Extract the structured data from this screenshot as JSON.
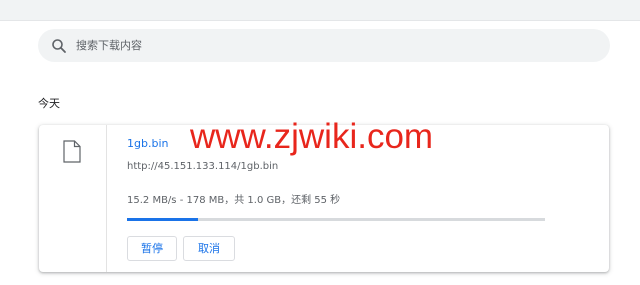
{
  "search": {
    "placeholder": "搜索下载内容"
  },
  "section": {
    "label": "今天"
  },
  "download": {
    "file_name": "1gb.bin",
    "url": "http://45.151.133.114/1gb.bin",
    "status": "15.2 MB/s - 178 MB，共 1.0 GB，还剩 55 秒",
    "progress": 0.17,
    "pause_label": "暂停",
    "cancel_label": "取消"
  },
  "watermark": "www.zjwiki.com",
  "colors": {
    "accent": "#1a73e8",
    "watermark": "#e8261c",
    "search_bg": "#f1f3f4"
  },
  "icons": {
    "search": "search-icon",
    "file": "file-icon"
  }
}
